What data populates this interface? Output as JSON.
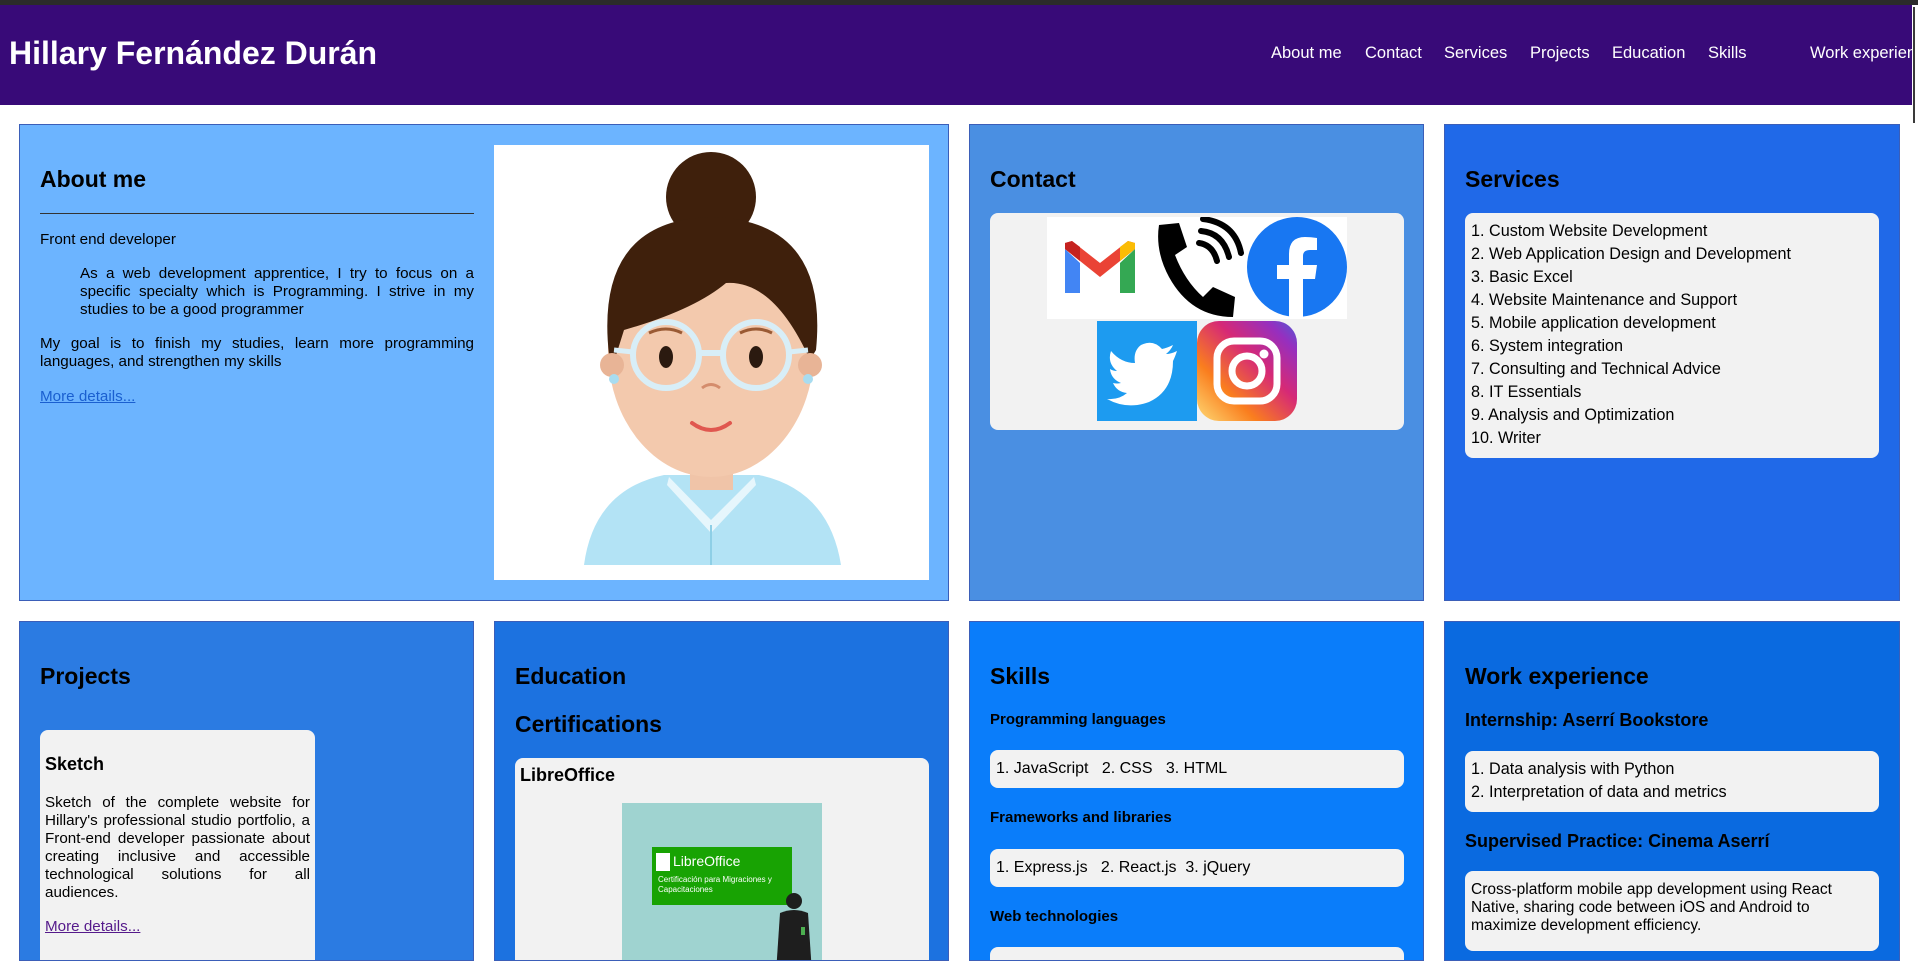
{
  "site_title": "Hillary Fernández Durán",
  "nav": [
    "About me",
    "Contact",
    "Services",
    "Projects",
    "Education",
    "Skills",
    "Work experience"
  ],
  "about": {
    "title": "About me",
    "role": "Front end developer",
    "quote": "As a web development apprentice, I try to focus on a specific specialty which is Programming. I strive in my studies to be a good programmer",
    "goal": "My goal is to finish my studies, learn more programming languages, and strengthen my skills",
    "more": "More details..."
  },
  "contact": {
    "title": "Contact",
    "icons": [
      "gmail-icon",
      "phone-icon",
      "facebook-icon",
      "twitter-icon",
      "instagram-icon"
    ]
  },
  "services": {
    "title": "Services",
    "items": [
      "1. Custom Website Development",
      "2. Web Application Design and Development",
      "3. Basic Excel",
      "4. Website Maintenance and Support",
      "5. Mobile application development",
      "6. System integration",
      "7. Consulting and Technical Advice",
      "8. IT Essentials",
      "9. Analysis and Optimization",
      "10. Writer"
    ]
  },
  "projects": {
    "title": "Projects",
    "card_title": "Sketch",
    "card_text": "Sketch of the complete website for Hillary's professional studio portfolio, a Front-end developer passionate about creating inclusive and accessible technological solutions for all audiences.",
    "more": "More details..."
  },
  "education": {
    "title": "Education",
    "subtitle": "Certifications",
    "cert_title": "LibreOffice",
    "cert_image_text": "LibreOffice",
    "cert_image_caption": "Certificación para Migraciones y Capacitaciones"
  },
  "skills": {
    "title": "Skills",
    "programming_title": "Programming languages",
    "programming": "1. JavaScript   2. CSS   3. HTML",
    "frameworks_title": "Frameworks and libraries",
    "frameworks": "1. Express.js   2. React.js  3. jQuery",
    "web_title": "Web technologies"
  },
  "work": {
    "title": "Work experience",
    "job1_title": "Internship: Aserrí Bookstore",
    "job1_items": [
      "1. Data analysis with Python",
      "2. Interpretation of data and metrics"
    ],
    "job2_title": "Supervised Practice: Cinema Aserrí",
    "job2_text": "Cross-platform mobile app development using React Native, sharing code between iOS and Android to maximize development efficiency."
  },
  "colors": {
    "header": "#380a78",
    "about_bg": "#6cb4ff",
    "contact_bg": "#4a8fe2",
    "services_bg": "#2069e8",
    "projects_bg": "#2b7be2",
    "education_bg": "#1c72e0",
    "skills_bg": "#0a7dfa",
    "work_bg": "#0a6ae0"
  }
}
